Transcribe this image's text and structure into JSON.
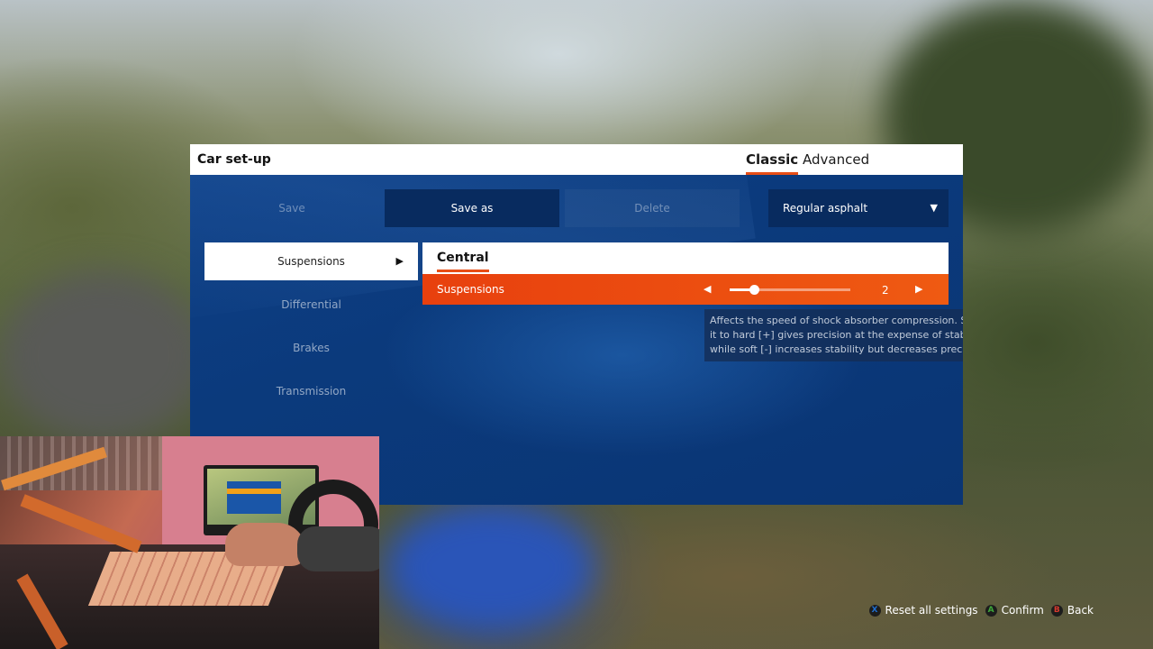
{
  "window": {
    "title": "Car set-up",
    "modes": [
      {
        "label": "Classic",
        "active": true
      },
      {
        "label": "Advanced",
        "active": false
      }
    ]
  },
  "toolbar": {
    "save_label": "Save",
    "save_as_label": "Save as",
    "delete_label": "Delete",
    "surface_value": "Regular asphalt",
    "surface_icon": "triangle-down-icon"
  },
  "sidebar": {
    "items": [
      {
        "label": "Suspensions",
        "selected": true
      },
      {
        "label": "Differential",
        "selected": false
      },
      {
        "label": "Brakes",
        "selected": false
      },
      {
        "label": "Transmission",
        "selected": false
      }
    ]
  },
  "main": {
    "section_title": "Central",
    "setting": {
      "label": "Suspensions",
      "value": "2",
      "slider_fraction": 0.2
    },
    "description": "Affects the speed of shock absorber compression. Setting it to hard [+] gives precision at the expense of stability, while soft [-] increases stability but decreases precision."
  },
  "footer": {
    "hints": [
      {
        "button": "X",
        "label": "Reset all settings",
        "color": "#1f6fd0"
      },
      {
        "button": "A",
        "label": "Confirm",
        "color": "#3ea83a"
      },
      {
        "button": "B",
        "label": "Back",
        "color": "#d63a2e"
      }
    ]
  },
  "colors": {
    "accent": "#e84e16",
    "panel_blue": "#0b3a7c"
  }
}
